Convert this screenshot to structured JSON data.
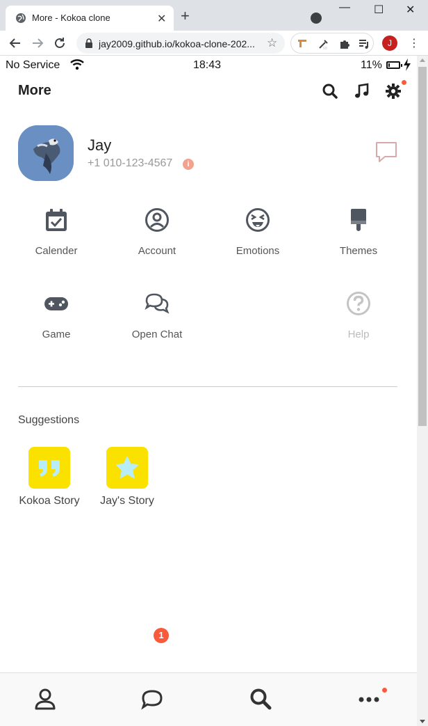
{
  "browser": {
    "tab_title": "More - Kokoa clone",
    "url": "jay2009.github.io/kokoa-clone-202...",
    "profile_initial": "J"
  },
  "status_bar": {
    "carrier": "No Service",
    "time": "18:43",
    "battery": "11%",
    "battery_level": 0.11
  },
  "header": {
    "title": "More"
  },
  "profile": {
    "name": "Jay",
    "phone": "+1 010-123-4567",
    "info_glyph": "i"
  },
  "menu": {
    "items": [
      {
        "label": "Calender",
        "icon": "calendar-check-icon"
      },
      {
        "label": "Account",
        "icon": "user-circle-icon"
      },
      {
        "label": "Emotions",
        "icon": "laugh-squint-tongue-icon"
      },
      {
        "label": "Themes",
        "icon": "paint-brush-icon"
      },
      {
        "label": "Game",
        "icon": "gamepad-icon"
      },
      {
        "label": "Open Chat",
        "icon": "comments-icon"
      },
      {
        "label": "Help",
        "icon": "question-circle-icon"
      }
    ]
  },
  "suggestions": {
    "title": "Suggestions",
    "items": [
      {
        "label": "Kokoa Story",
        "icon": "quote-icon"
      },
      {
        "label": "Jay's Story",
        "icon": "star-icon"
      }
    ]
  },
  "tabbar": {
    "chats_badge": "1"
  },
  "colors": {
    "accent_yellow": "#fae100",
    "notification": "#fa5a3c",
    "suggestion_icon": "#b8ecf7"
  }
}
